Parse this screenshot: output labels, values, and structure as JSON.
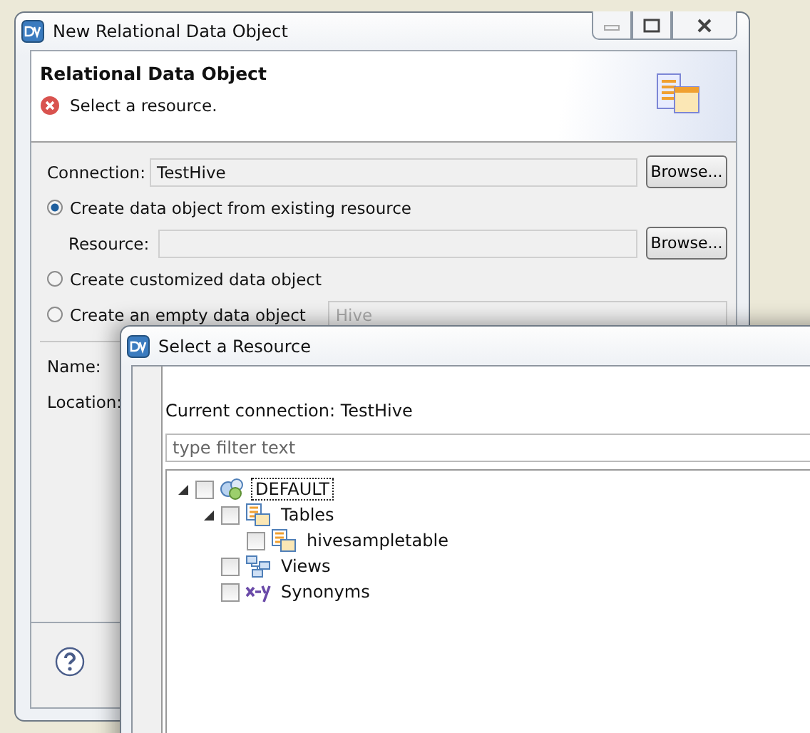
{
  "main_window": {
    "title": "New Relational Data Object",
    "header": {
      "title": "Relational Data Object",
      "message": "Select a resource."
    },
    "connection": {
      "label": "Connection:",
      "value": "TestHive",
      "button": "Browse..."
    },
    "options": [
      {
        "label": "Create data object from existing resource",
        "selected": true,
        "kind": "resource"
      },
      {
        "label": "Create customized data object",
        "selected": false,
        "kind": "plain"
      },
      {
        "label": "Create an empty data object",
        "selected": false,
        "kind": "combo"
      }
    ],
    "resource": {
      "label": "Resource:",
      "button": "Browse..."
    },
    "combo_value": "Hive",
    "name_label": "Name:",
    "location_label": "Location:"
  },
  "dialog": {
    "title": "Select a Resource",
    "connection_text": "Current connection: TestHive",
    "filter": {
      "placeholder": "type filter text"
    },
    "tree": [
      {
        "label": "DEFAULT",
        "kind": "schema",
        "checked": false,
        "selected": true,
        "expanded": true,
        "children": [
          {
            "label": "Tables",
            "kind": "tables",
            "checked": false,
            "selected": false,
            "expanded": true,
            "children": [
              {
                "label": "hivesampletable",
                "kind": "table",
                "checked": false,
                "selected": false
              }
            ]
          },
          {
            "label": "Views",
            "kind": "views",
            "checked": false,
            "selected": false
          },
          {
            "label": "Synonyms",
            "kind": "synonyms",
            "checked": false,
            "selected": false
          }
        ]
      }
    ]
  }
}
